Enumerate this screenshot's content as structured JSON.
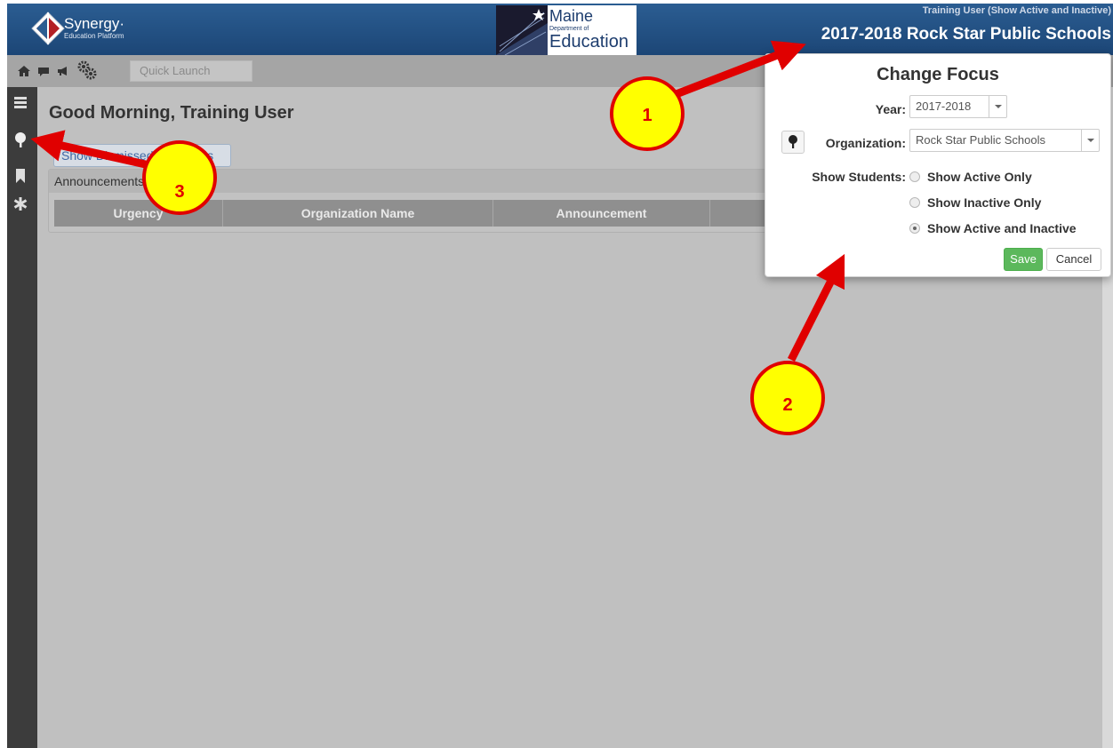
{
  "header": {
    "brand_name": "Synergy·",
    "brand_sub": "Education Platform",
    "doe_line1": "Maine",
    "doe_line2": "Department of",
    "doe_line3": "Education",
    "user_label": "Training User (Show Active and Inactive)",
    "focus_label": "2017-2018 Rock Star Public Schools"
  },
  "toolbar": {
    "icons": [
      "home-icon",
      "chat-icon",
      "megaphone-icon",
      "gears-icon"
    ],
    "quick_launch_placeholder": "Quick Launch"
  },
  "sidebar": {
    "icons": [
      "menu-icon",
      "tree-icon",
      "bookmark-icon",
      "asterisk-icon"
    ]
  },
  "main": {
    "greeting": "Good Morning, Training User",
    "dismiss_button": "Show Dismissed Messages",
    "announcements_title": "Announcements",
    "table_headers": [
      "Urgency",
      "Organization Name",
      "Announcement",
      ""
    ]
  },
  "change_focus": {
    "title": "Change Focus",
    "year_label": "Year:",
    "year_value": "2017-2018",
    "org_label": "Organization:",
    "org_value": "Rock Star Public Schools",
    "students_label": "Show Students:",
    "options": [
      {
        "label": "Show Active Only",
        "checked": false
      },
      {
        "label": "Show Inactive Only",
        "checked": false
      },
      {
        "label": "Show Active and Inactive",
        "checked": true
      }
    ],
    "save_label": "Save",
    "cancel_label": "Cancel"
  },
  "annotations": {
    "badges": [
      "1",
      "2",
      "3"
    ],
    "color_arrow": "#e00000",
    "color_badge": "#ffff00"
  }
}
